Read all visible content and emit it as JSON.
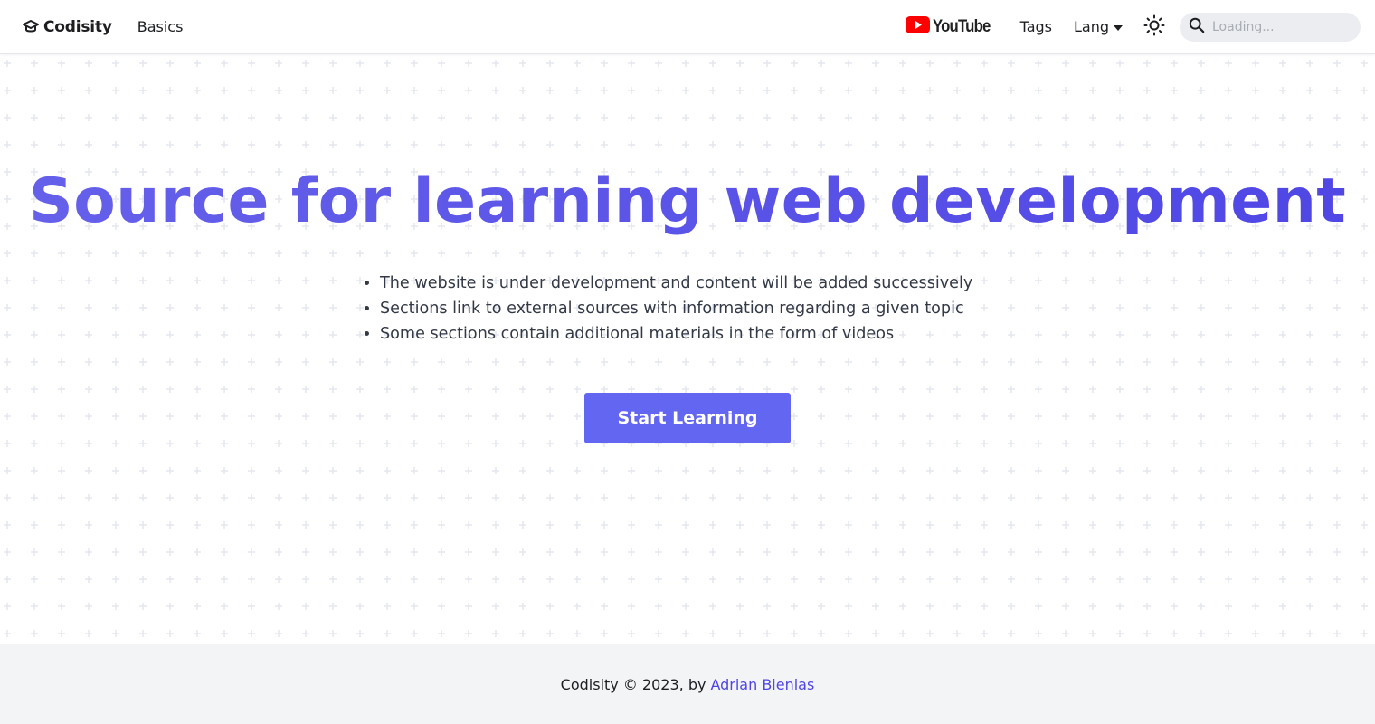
{
  "nav": {
    "brand": "Codisity",
    "basics": "Basics",
    "youtube": "YouTube",
    "tags": "Tags",
    "lang": "Lang",
    "search_placeholder": "Loading...",
    "icons": {
      "brand": "graduation-cap-icon",
      "youtube": "youtube-play-icon",
      "lang": "caret-down-icon",
      "theme": "sun-icon",
      "search": "search-icon"
    }
  },
  "hero": {
    "title": "Source for learning web development",
    "points": [
      "The website is under development and content will be added successively",
      "Sections link to external sources with information regarding a given topic",
      "Some sections contain additional materials in the form of videos"
    ],
    "cta": "Start Learning"
  },
  "footer": {
    "text": "Codisity © 2023, by",
    "author": "Adrian Bienias"
  },
  "colors": {
    "accent": "#6366f1",
    "title": "#4f46e5",
    "youtube_red": "#ff0000",
    "footer_bg": "#f3f4f6"
  }
}
